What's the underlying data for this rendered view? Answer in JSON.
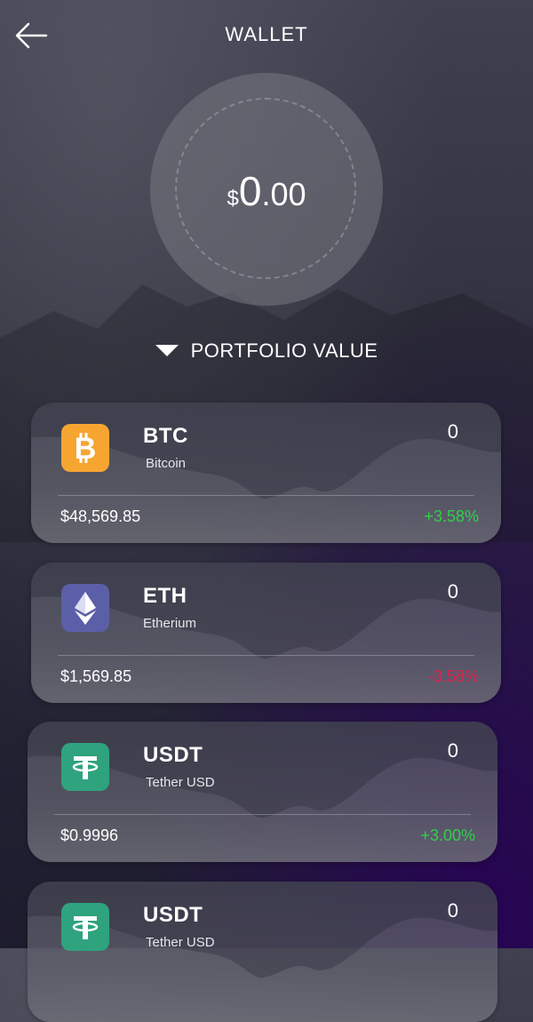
{
  "header": {
    "title": "WALLET",
    "back_icon": "arrow-left-icon"
  },
  "portfolio": {
    "currency_symbol": "$",
    "value_int": "0",
    "value_dec": ".00",
    "label": "PORTFOLIO VALUE",
    "toggle_icon": "caret-down-icon"
  },
  "colors": {
    "positive": "#2fd14a",
    "negative": "#e0224a",
    "btc": "#f7a531",
    "eth": "#5b5fa8",
    "usdt": "#2fa37e"
  },
  "coins": [
    {
      "symbol": "BTC",
      "name": "Bitcoin",
      "quantity": "0",
      "price": "$48,569.85",
      "change": "+3.58%",
      "direction": "up",
      "icon": "bitcoin-icon"
    },
    {
      "symbol": "ETH",
      "name": "Etherium",
      "quantity": "0",
      "price": "$1,569.85",
      "change": "-3.58%",
      "direction": "down",
      "icon": "ethereum-icon"
    },
    {
      "symbol": "USDT",
      "name": "Tether USD",
      "quantity": "0",
      "price": "$0.9996",
      "change": "+3.00%",
      "direction": "up",
      "icon": "tether-icon"
    },
    {
      "symbol": "USDT",
      "name": "Tether USD",
      "quantity": "0",
      "price": "",
      "change": "",
      "direction": "up",
      "icon": "tether-icon"
    }
  ]
}
